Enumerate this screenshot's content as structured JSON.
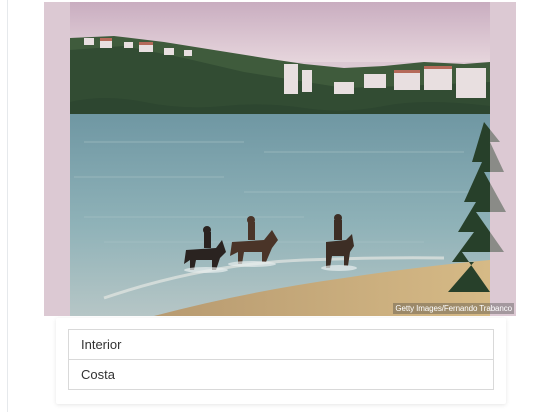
{
  "photo": {
    "credit": "Getty Images/Fernando Trabanco"
  },
  "options": [
    {
      "label": "Interior"
    },
    {
      "label": "Costa"
    }
  ],
  "colors": {
    "frame": "#dcc9d3",
    "sky": "#d9c4cf",
    "water": "#7ea3ad",
    "sand": "#c9ae7d",
    "trees": "#3d5b3a",
    "option_border": "#d9d9d9"
  }
}
